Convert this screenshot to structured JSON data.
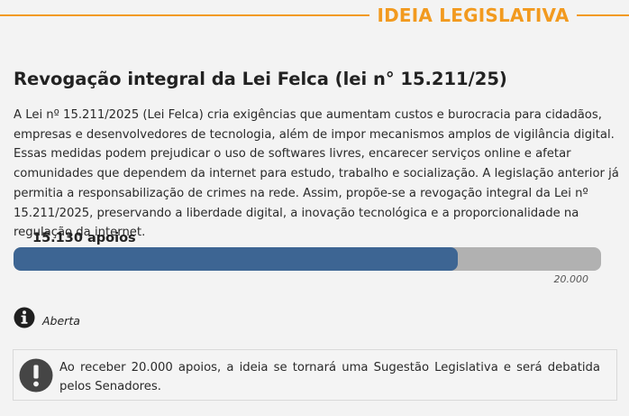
{
  "header": {
    "title": "IDEIA LEGISLATIVA",
    "accent_color": "#f29a1f"
  },
  "idea": {
    "title": "Revogação integral da Lei Felca (lei n° 15.211/25)",
    "description": "A Lei nº 15.211/2025 (Lei Felca) cria exigências que aumentam custos e burocracia para cidadãos, empresas e desenvolvedores de tecnologia, além de impor mecanismos amplos de vigilância digital. Essas medidas podem prejudicar o uso de softwares livres, encarecer serviços online e afetar comunidades que dependem da internet para estudo, trabalho e socialização. A legislação anterior já permitia a responsabilização de crimes na rede. Assim, propõe-se a revogação integral da Lei nº 15.211/2025, preservando a liberdade digital, a inovação tecnológica e a proporcionalidade na regulação da internet."
  },
  "support": {
    "count_label": "15.130 apoios",
    "current": 15130,
    "goal": 20000,
    "goal_label": "20.000",
    "progress_fraction": 0.7565,
    "fill_color": "#3d6593",
    "track_color": "#b1b1b1"
  },
  "status": {
    "icon": "info-icon",
    "label": "Aberta"
  },
  "notice": {
    "icon": "exclamation-icon",
    "text": "Ao receber 20.000 apoios, a ideia se tornará uma Sugestão Legislativa e será debatida pelos Senadores."
  }
}
